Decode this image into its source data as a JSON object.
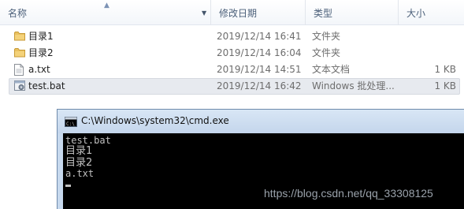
{
  "columns": {
    "name": "名称",
    "date": "修改日期",
    "type": "类型",
    "size": "大小"
  },
  "files": [
    {
      "name": "目录1",
      "date": "2019/12/14 16:41",
      "type": "文件夹",
      "size": "",
      "icon": "folder-icon",
      "selected": false
    },
    {
      "name": "目录2",
      "date": "2019/12/14 16:04",
      "type": "文件夹",
      "size": "",
      "icon": "folder-icon",
      "selected": false
    },
    {
      "name": "a.txt",
      "date": "2019/12/14 14:51",
      "type": "文本文档",
      "size": "1 KB",
      "icon": "text-file-icon",
      "selected": false
    },
    {
      "name": "test.bat",
      "date": "2019/12/14 16:42",
      "type": "Windows 批处理...",
      "size": "1 KB",
      "icon": "batch-file-icon",
      "selected": true
    }
  ],
  "cmd": {
    "title": "C:\\Windows\\system32\\cmd.exe",
    "lines": [
      "test.bat",
      "目录1",
      "目录2",
      "a.txt"
    ]
  },
  "watermark": "https://blog.csdn.net/qq_33308125",
  "colors": {
    "selection": "#e7eaef",
    "folder": "#e9c160",
    "console_bg": "#000000",
    "console_text": "#c0c0c0"
  }
}
